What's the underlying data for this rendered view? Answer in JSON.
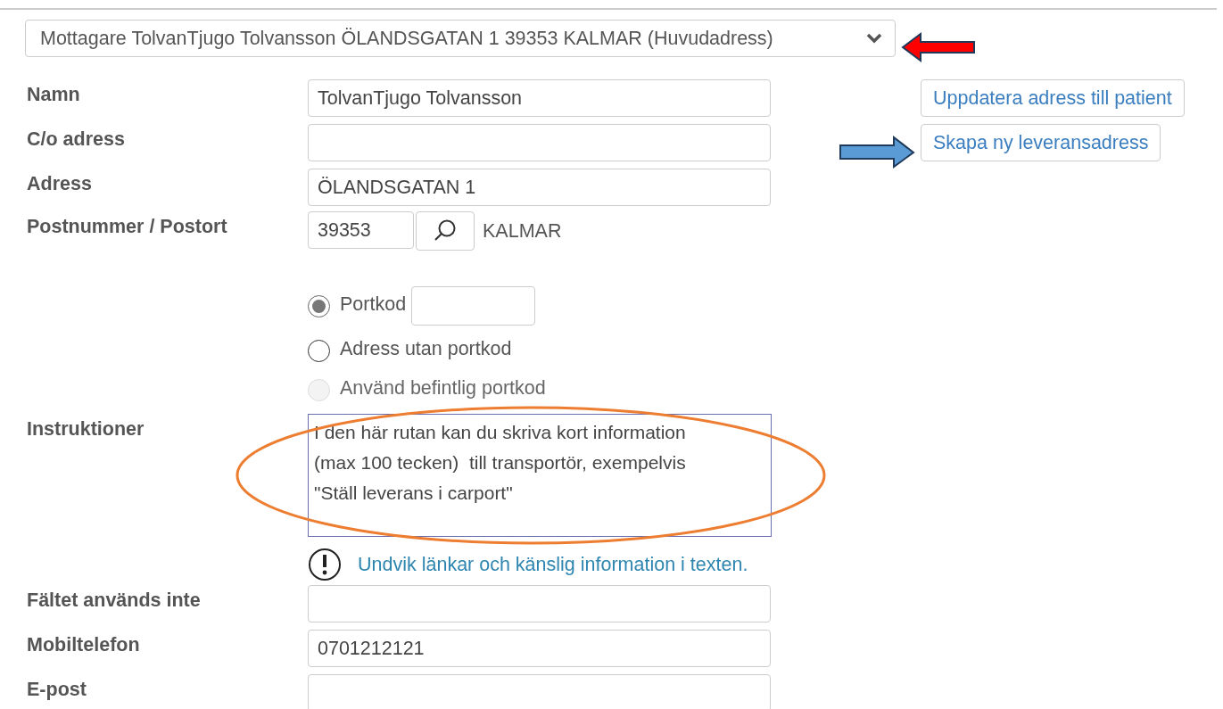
{
  "recipient_select": {
    "value": "Mottagare TolvanTjugo Tolvansson ÖLANDSGATAN 1 39353 KALMAR (Huvudadress)"
  },
  "side_buttons": [
    "Uppdatera adress till patient",
    "Skapa ny leveransadress"
  ],
  "rows": [
    {
      "kind": "text",
      "label": "Namn",
      "value": "TolvanTjugo Tolvansson"
    },
    {
      "kind": "text",
      "label": "C/o adress"
    },
    {
      "kind": "text",
      "label": "Adress",
      "value": "ÖLANDSGATAN 1"
    },
    {
      "kind": "postcode",
      "label": "Postnummer / Postort",
      "value": "39353",
      "city": "KALMAR"
    },
    {
      "kind": "radios",
      "options": [
        {
          "label": "Portkod",
          "selected": true,
          "disabled": false,
          "with_field": true
        },
        {
          "label": "Adress utan portkod",
          "selected": false,
          "disabled": false
        },
        {
          "label": "Använd befintlig portkod",
          "selected": false,
          "disabled": true
        }
      ]
    },
    {
      "kind": "textarea",
      "label": "Instruktioner",
      "value": "I den här rutan kan du skriva kort information\n(max 100 tecken)  till transportör, exempelvis\n\"Ställ leverans i carport\""
    },
    {
      "kind": "note",
      "text": "Undvik länkar och känslig information i texten."
    },
    {
      "kind": "text",
      "label": "Fältet används inte"
    },
    {
      "kind": "text",
      "label": "Mobiltelefon",
      "value": "0701212121"
    },
    {
      "kind": "text",
      "label": "E-post"
    }
  ],
  "annotations": [
    {
      "kind": "arrow-left",
      "color": "#ff0000"
    },
    {
      "kind": "arrow-right",
      "color": "#5b9bd5"
    },
    {
      "kind": "ellipse",
      "color": "#ed7d31"
    }
  ]
}
